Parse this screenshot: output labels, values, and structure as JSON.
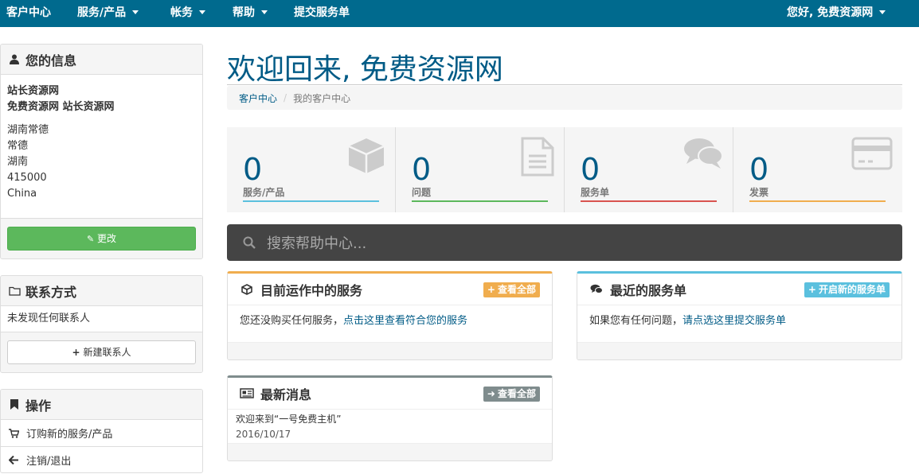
{
  "navbar": {
    "brand": "客户中心",
    "items": [
      "服务/产品",
      "帐务",
      "帮助",
      "提交服务单"
    ],
    "user": "您好, 免费资源网"
  },
  "sidebar": {
    "info": {
      "title": "您的信息",
      "name": "站长资源网",
      "company": "免费资源网 站长资源网",
      "address": [
        "湖南常德",
        "常德",
        "湖南",
        "415000",
        "China"
      ],
      "edit_label": "更改"
    },
    "contacts": {
      "title": "联系方式",
      "empty": "未发现任何联系人",
      "new_label": "新建联系人"
    },
    "actions": {
      "title": "操作",
      "items": [
        "订购新的服务/产品",
        "注销/退出"
      ]
    }
  },
  "main": {
    "title": "欢迎回来, 免费资源网",
    "breadcrumb": [
      "客户中心",
      "我的客户中心"
    ],
    "tiles": [
      {
        "value": "0",
        "label": "服务/产品",
        "color": "#5bc0de"
      },
      {
        "value": "0",
        "label": "问题",
        "color": "#5cb85c"
      },
      {
        "value": "0",
        "label": "服务单",
        "color": "#d9534f"
      },
      {
        "value": "0",
        "label": "发票",
        "color": "#f0ad4e"
      }
    ],
    "search_placeholder": "搜索帮助中心...",
    "services_box": {
      "title": "目前运作中的服务",
      "button": "查看全部",
      "text": "您还没购买任何服务，",
      "link": "点击这里查看符合您的服务"
    },
    "tickets_box": {
      "title": "最近的服务单",
      "button": "开启新的服务单",
      "text": "如果您有任何问题，",
      "link": "请点选这里提交服务单"
    },
    "news_box": {
      "title": "最新消息",
      "button": "查看全部",
      "item_title": "欢迎来到“一号免费主机”",
      "item_date": "2016/10/17"
    }
  }
}
